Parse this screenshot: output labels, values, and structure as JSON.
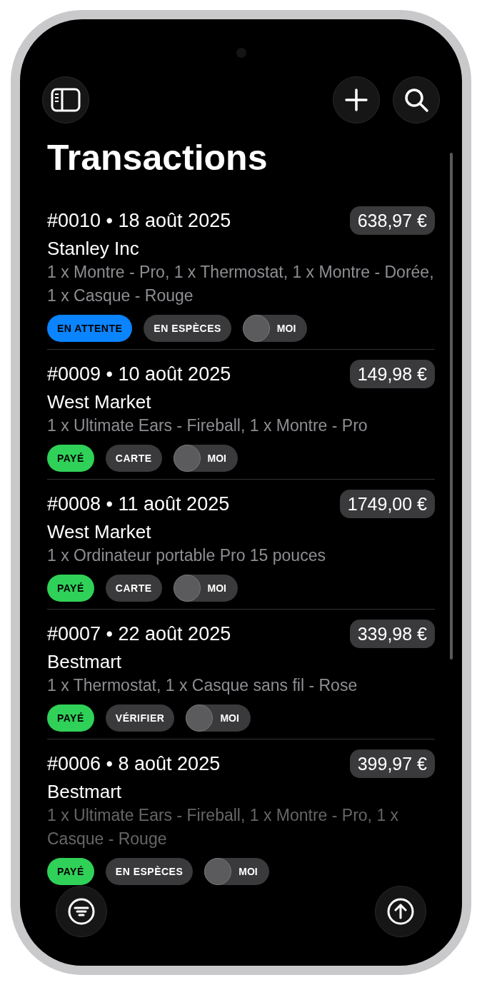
{
  "header": {
    "title": "Transactions"
  },
  "transactions": [
    {
      "number_date": "#0010 • 18 août 2025",
      "amount": "638,97 €",
      "customer": "Stanley Inc",
      "items": "1 x Montre - Pro, 1 x Thermostat, 1 x Montre - Dorée, 1 x Casque - Rouge",
      "status": {
        "label": "EN ATTENTE",
        "color": "#0a84ff"
      },
      "payment": "EN ESPÈCES",
      "assignee": "MOI"
    },
    {
      "number_date": "#0009 • 10 août 2025",
      "amount": "149,98 €",
      "customer": "West Market",
      "items": "1 x Ultimate Ears - Fireball, 1 x Montre - Pro",
      "status": {
        "label": "PAYÉ",
        "color": "#30d158"
      },
      "payment": "CARTE",
      "assignee": "MOI"
    },
    {
      "number_date": "#0008 • 11 août 2025",
      "amount": "1749,00 €",
      "customer": "West Market",
      "items": "1 x Ordinateur portable Pro 15 pouces",
      "status": {
        "label": "PAYÉ",
        "color": "#30d158"
      },
      "payment": "CARTE",
      "assignee": "MOI"
    },
    {
      "number_date": "#0007 • 22 août 2025",
      "amount": "339,98 €",
      "customer": "Bestmart",
      "items": "1 x Thermostat, 1 x Casque sans fil - Rose",
      "status": {
        "label": "PAYÉ",
        "color": "#30d158"
      },
      "payment": "VÉRIFIER",
      "assignee": "MOI"
    },
    {
      "number_date": "#0006 • 8 août 2025",
      "amount": "399,97 €",
      "customer": "Bestmart",
      "items": "1 x Ultimate Ears - Fireball, 1 x Montre - Pro, 1 x Casque - Rouge",
      "status": {
        "label": "PAYÉ",
        "color": "#30d158"
      },
      "payment": "EN ESPÈCES",
      "assignee": "MOI"
    }
  ]
}
